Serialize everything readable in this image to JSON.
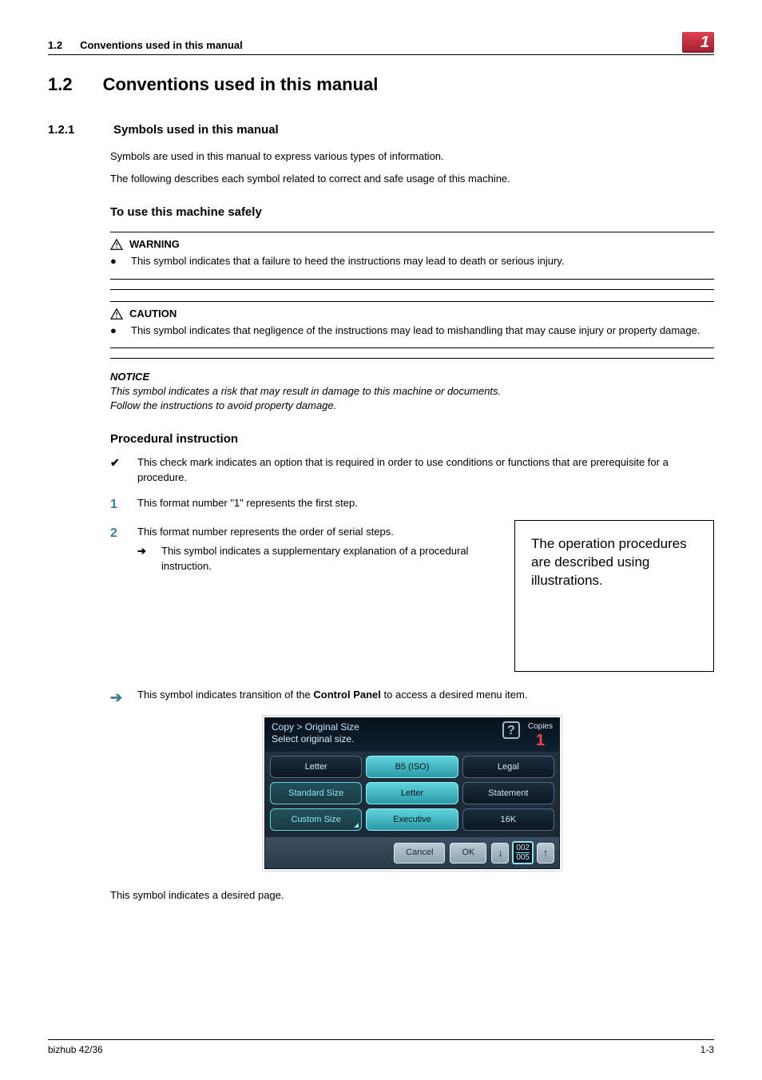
{
  "header": {
    "section_num": "1.2",
    "section_title": "Conventions used in this manual",
    "chapter_badge": "1"
  },
  "h1": {
    "num": "1.2",
    "title": "Conventions used in this manual"
  },
  "h2": {
    "num": "1.2.1",
    "title": "Symbols used in this manual"
  },
  "intro1": "Symbols are used in this manual to express various types of information.",
  "intro2": "The following describes each symbol related to correct and safe usage of this machine.",
  "h3_safely": "To use this machine safely",
  "warning": {
    "label": "WARNING",
    "text": "This symbol indicates that a failure to heed the instructions may lead to death or serious injury."
  },
  "caution": {
    "label": "CAUTION",
    "text": "This symbol indicates that negligence of the instructions may lead to mishandling that may cause injury or property damage."
  },
  "notice": {
    "label": "NOTICE",
    "line1": "This symbol indicates a risk that may result in damage to this machine or documents.",
    "line2": "Follow the instructions to avoid property damage."
  },
  "h3_proc": "Procedural instruction",
  "proc_check": "This check mark indicates an option that is required in order to use conditions or functions that are prerequisite for a procedure.",
  "proc_step1_num": "1",
  "proc_step1_text": "This format number \"1\" represents the first step.",
  "proc_step2_num": "2",
  "proc_step2_text": "This format number represents the order of serial steps.",
  "proc_sub_arrow": "➔",
  "proc_sub_text": "This symbol indicates a supplementary explanation of a procedural instruction.",
  "illus_box": "The operation procedures are described using illustrations.",
  "transition_text_a": "This symbol indicates transition of the ",
  "transition_bold": "Control Panel",
  "transition_text_b": " to access a desired menu item.",
  "panel": {
    "breadcrumb": "Copy > Original Size",
    "instruction": "Select original size.",
    "copies_label": "Copies",
    "copies_value": "1",
    "row1": [
      "Letter",
      "B5 (ISO)",
      "Legal"
    ],
    "row2": [
      "Standard Size",
      "Letter",
      "Statement"
    ],
    "row3": [
      "Custom Size",
      "Executive",
      "16K"
    ],
    "cancel": "Cancel",
    "ok": "OK",
    "page_current": "002",
    "page_total": "005"
  },
  "closing": "This symbol indicates a desired page.",
  "footer": {
    "left": "bizhub 42/36",
    "right": "1-3"
  }
}
